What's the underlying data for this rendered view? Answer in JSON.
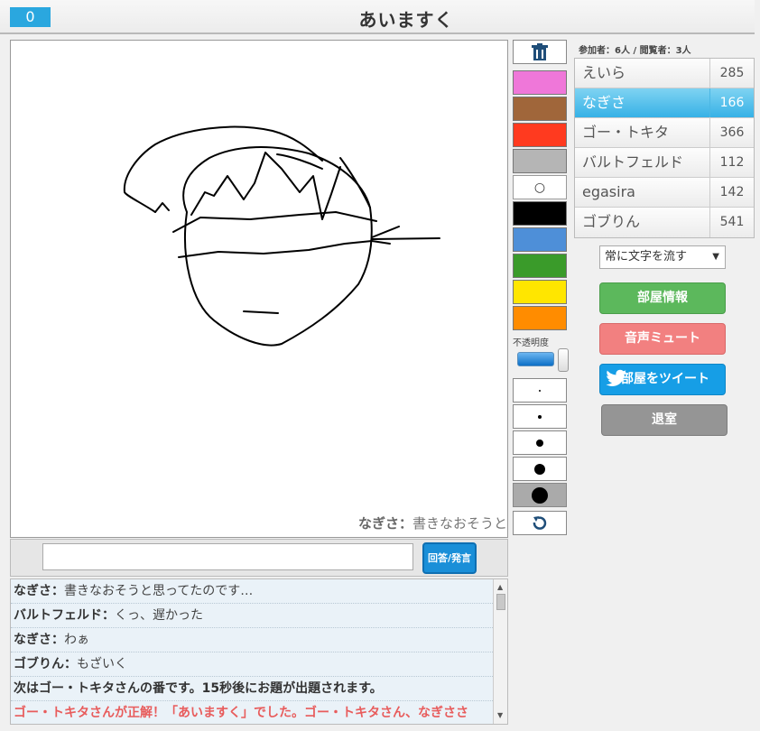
{
  "header": {
    "counter": "0",
    "title": "あいますく"
  },
  "canvas": {
    "overlay_name": "なぎさ",
    "overlay_sep": "：",
    "overlay_text": "書きなおそうと"
  },
  "tools": {
    "trash_icon": "trash-icon",
    "colors": [
      "#ef77d9",
      "#a0663a",
      "#ff3a1f",
      "#b5b5b5",
      "#ffffff",
      "#000000",
      "#4e8fd8",
      "#3a9b2a",
      "#ffe600",
      "#ff8c00"
    ],
    "eraser_glyph": "○",
    "opacity_label": "不透明度",
    "opacity_value": 0.85,
    "brush_sizes": [
      2,
      4,
      8,
      12,
      18
    ],
    "selected_size_index": 4,
    "undo_icon": "undo-icon"
  },
  "players_header": "参加者：6人 / 閲覧者：3人",
  "players": [
    {
      "name": "えいら",
      "score": "285"
    },
    {
      "name": "なぎさ",
      "score": "166",
      "active": true
    },
    {
      "name": "ゴー・トキタ",
      "score": "366"
    },
    {
      "name": "バルトフェルド",
      "score": "112"
    },
    {
      "name": "egasira",
      "score": "142"
    },
    {
      "name": "ゴブりん",
      "score": "541"
    }
  ],
  "select": {
    "value": "常に文字を流す"
  },
  "buttons": {
    "room_info": "部屋情報",
    "mute": "音声ミュート",
    "tweet": "部屋をツイート",
    "leave": "退室"
  },
  "input": {
    "placeholder": "",
    "send_label": "回答/発言"
  },
  "chat": [
    {
      "name": "なぎさ",
      "text": "書きなおそうと思ってたのです…"
    },
    {
      "name": "バルトフェルド",
      "text": "くっ、遅かった"
    },
    {
      "name": "なぎさ",
      "text": "わぁ"
    },
    {
      "name": "ゴブりん",
      "text": "もざいく"
    },
    {
      "system": "次はゴー・トキタさんの番です。15秒後にお題が出題されます。"
    },
    {
      "winner": "ゴー・トキタさんが正解！「あいますく」でした。ゴー・トキタさん、なぎささ"
    }
  ],
  "colors": {
    "accent": "#2aa7df",
    "active_row": "#36b1e6",
    "chat_bg": "#eaf2f8",
    "winner_text": "#e85c5c"
  }
}
